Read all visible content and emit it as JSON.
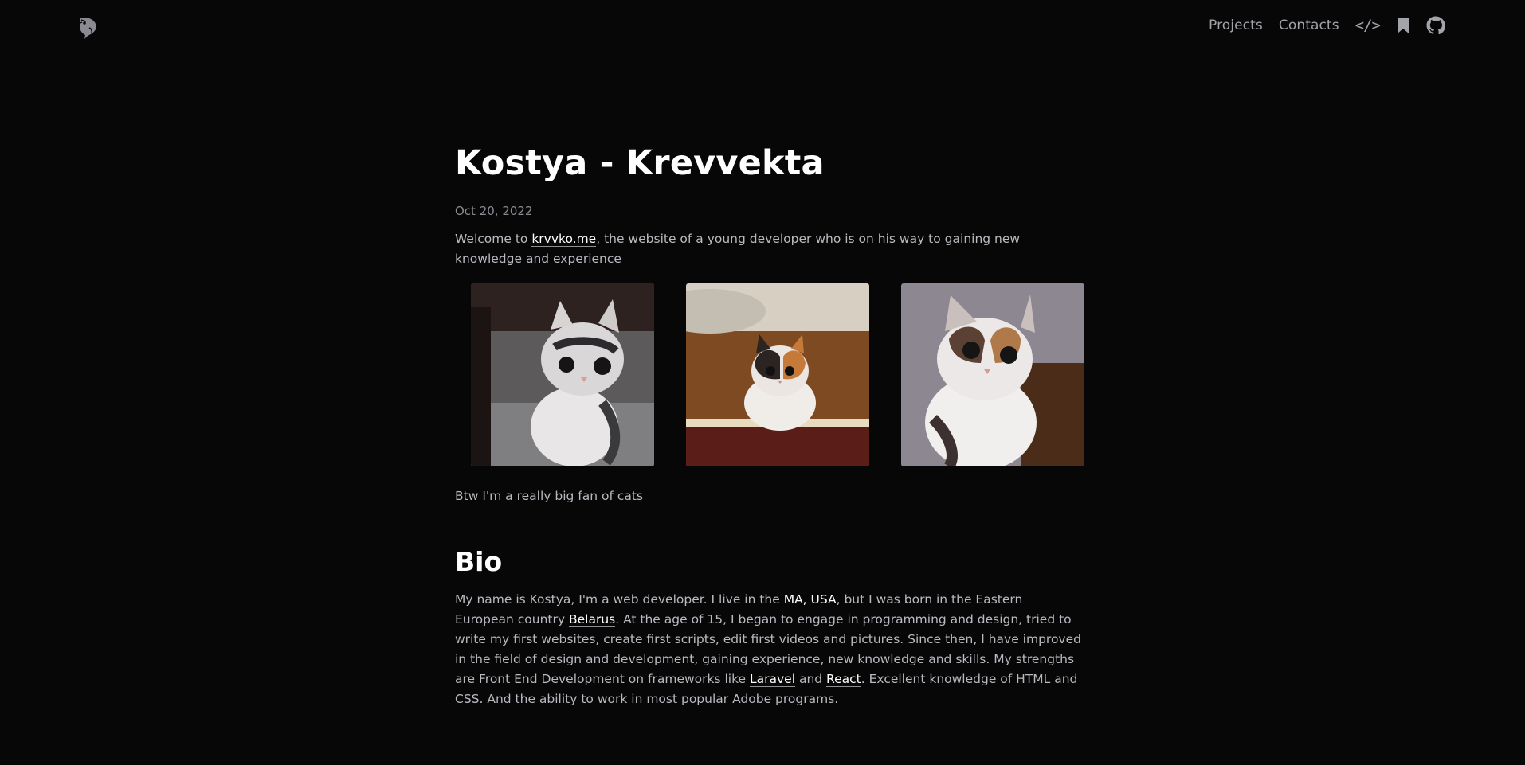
{
  "nav": {
    "projects": "Projects",
    "contacts": "Contacts",
    "code_icon_text": "</>"
  },
  "page": {
    "title": "Kostya - Krevvekta",
    "date": "Oct 20, 2022",
    "intro_before": "Welcome to ",
    "intro_link": "krvvko.me",
    "intro_after": ", the website of a young developer who is on his way to gaining new knowledge and experience",
    "cats_note": "Btw I'm a really big fan of cats"
  },
  "bio": {
    "heading": "Bio",
    "t1": "My name is Kostya, I'm a web developer. I live in the ",
    "link_location": "MA, USA",
    "t2": ", but I was born in the Eastern European country ",
    "link_country": "Belarus",
    "t3": ". At the age of 15, I began to engage in programming and design, tried to write my first websites, create first scripts, edit first videos and pictures. Since then, I have improved in the field of design and development, gaining experience, new knowledge and skills. My strengths are Front End Development on frameworks like ",
    "link_laravel": "Laravel",
    "t4": " and ",
    "link_react": "React",
    "t5": ". Excellent knowledge of HTML and CSS. And the ability to work in most popular Adobe programs."
  },
  "icons": [
    "logo-icon",
    "code-icon",
    "bookmark-icon",
    "github-icon"
  ],
  "colors": {
    "background": "#070708",
    "text": "#b9b9bf",
    "heading": "#ffffff",
    "muted": "#8c8c93"
  }
}
